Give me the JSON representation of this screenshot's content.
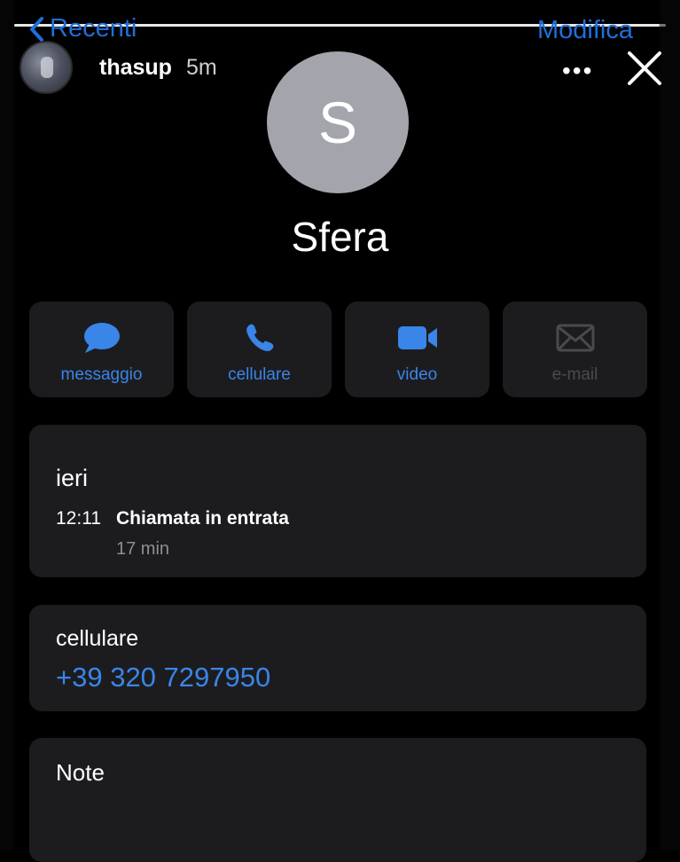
{
  "nav": {
    "back_label": "Recenti",
    "edit_label": "Modifica"
  },
  "story": {
    "username": "thasup",
    "time": "5m",
    "progress": 0.99
  },
  "contact": {
    "initial": "S",
    "name": "Sfera"
  },
  "actions": [
    {
      "label": "messaggio",
      "icon": "message-icon",
      "enabled": true
    },
    {
      "label": "cellulare",
      "icon": "phone-icon",
      "enabled": true
    },
    {
      "label": "video",
      "icon": "video-icon",
      "enabled": true
    },
    {
      "label": "e-mail",
      "icon": "mail-icon",
      "enabled": false
    }
  ],
  "recent_call": {
    "day": "ieri",
    "time": "12:11",
    "type": "Chiamata in entrata",
    "duration": "17 min"
  },
  "phone": {
    "label": "cellulare",
    "number": "+39 320 7297950"
  },
  "notes": {
    "label": "Note"
  },
  "colors": {
    "accent": "#3a85e8",
    "card": "#1c1c1f",
    "background": "#000000"
  }
}
